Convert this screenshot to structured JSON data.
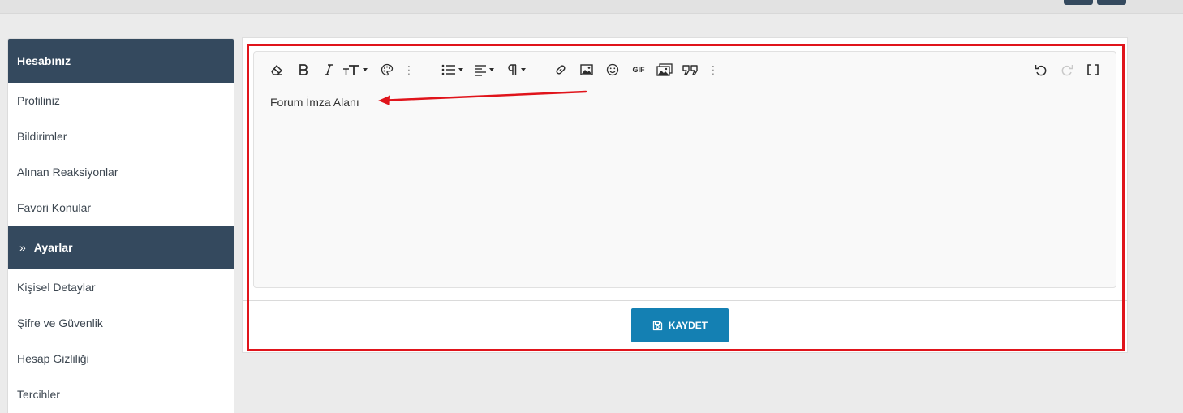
{
  "sidebar": {
    "header": "Hesabınız",
    "items_top": [
      {
        "label": "Profiliniz"
      },
      {
        "label": "Bildirimler"
      },
      {
        "label": "Alınan Reaksiyonlar"
      },
      {
        "label": "Favori Konular"
      }
    ],
    "section": {
      "label": "Ayarlar",
      "icon": "double-chevron-right-icon"
    },
    "items_bottom": [
      {
        "label": "Kişisel Detaylar"
      },
      {
        "label": "Şifre ve Güvenlik"
      },
      {
        "label": "Hesap Gizliliği"
      },
      {
        "label": "Tercihler"
      }
    ]
  },
  "editor": {
    "content": "Forum İmza Alanı",
    "toolbar": {
      "gif_label": "GIF",
      "buttons": [
        "eraser-icon",
        "bold-icon",
        "italic-icon",
        "font-size-icon",
        "palette-icon",
        "more-icon",
        "list-icon",
        "align-icon",
        "paragraph-icon",
        "link-icon",
        "image-icon",
        "smiley-icon",
        "gif-icon",
        "media-gallery-icon",
        "quote-icon",
        "more-icon",
        "undo-icon",
        "redo-icon",
        "fullscreen-icon"
      ]
    }
  },
  "save_button": {
    "label": "KAYDET",
    "icon": "save-icon"
  },
  "colors": {
    "sidebar_header": "#34495e",
    "save_button": "#1480b3",
    "annotation": "#e0141b"
  }
}
